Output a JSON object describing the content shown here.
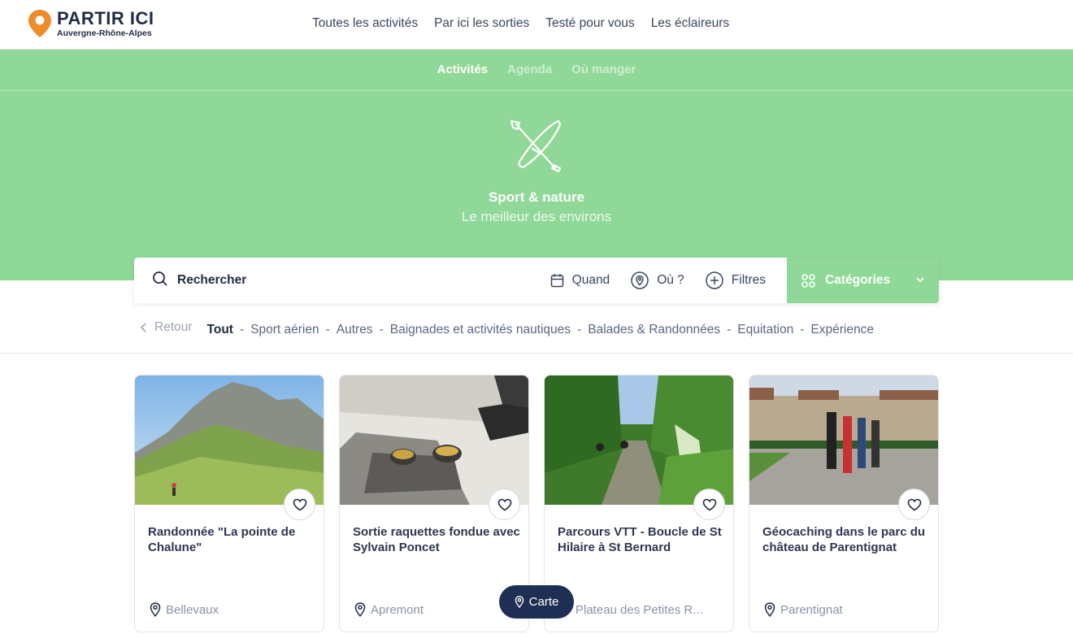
{
  "brand": {
    "title": "PARTIR ICI",
    "subtitle": "Auvergne-Rhône-Alpes",
    "pin_color": "#f08a2a"
  },
  "top_nav": [
    {
      "label": "Toutes les activités"
    },
    {
      "label": "Par ici les sorties"
    },
    {
      "label": "Testé pour vous"
    },
    {
      "label": "Les éclaireurs"
    }
  ],
  "sub_nav": [
    {
      "label": "Activités",
      "active": true
    },
    {
      "label": "Agenda",
      "active": false
    },
    {
      "label": "Où manger",
      "active": false
    }
  ],
  "hero": {
    "icon": "kayak-paddle-icon",
    "title": "Sport & nature",
    "subtitle": "Le meilleur des environs",
    "color": "#90d898"
  },
  "search": {
    "label": "Rechercher",
    "when": "Quand",
    "where": "Où ?",
    "filters": "Filtres",
    "categories": "Catégories"
  },
  "filter_row": {
    "back": "Retour",
    "items": [
      "Tout",
      "Sport aérien",
      "Autres",
      "Baignades et activités nautiques",
      "Balades & Randonnées",
      "Equitation",
      "Expérience"
    ],
    "active": "Tout"
  },
  "cards": [
    {
      "title": "Randonnée \"La pointe de Chalune\"",
      "location": "Bellevaux",
      "image": "mountain-hike-photo"
    },
    {
      "title": "Sortie raquettes fondue avec Sylvain Poncet",
      "location": "Apremont",
      "image": "fondue-snow-photo"
    },
    {
      "title": "Parcours VTT - Boucle de St Hilaire à St Bernard",
      "location": "Plateau des Petites R...",
      "image": "forest-bike-photo"
    },
    {
      "title": "Géocaching dans le parc du château de Parentignat",
      "location": "Parentignat",
      "image": "castle-family-photo"
    }
  ],
  "map_button": {
    "label": "Carte"
  },
  "colors": {
    "accent_green": "#90d898",
    "navy": "#1f2f54",
    "text": "#1f2a44"
  }
}
